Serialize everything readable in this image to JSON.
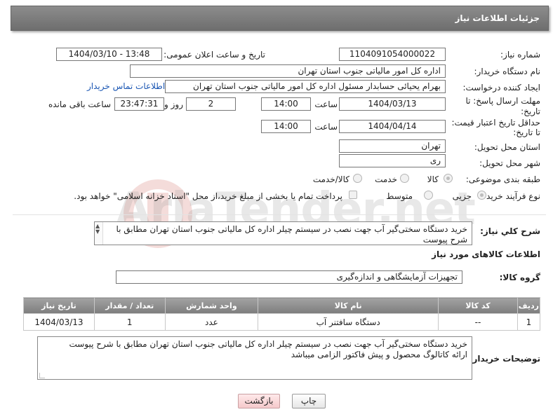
{
  "header": {
    "title": "جزئیات اطلاعات نیاز"
  },
  "fields": {
    "need_number_label": "شماره نیاز:",
    "need_number": "1104091054000022",
    "announce_label": "تاریخ و ساعت اعلان عمومی:",
    "announce_value": "1404/03/10 - 13:48",
    "buyer_org_label": "نام دستگاه خریدار:",
    "buyer_org": "اداره کل امور مالیاتی جنوب استان تهران",
    "requester_label": "ایجاد کننده درخواست:",
    "requester": "بهرام یحیائی حسابدار مسئول اداره کل امور مالیاتی جنوب استان تهران",
    "contact_link": "اطلاعات تماس خریدار",
    "deadline_label_1": "مهلت ارسال پاسخ: تا",
    "deadline_label_2": "تاریخ:",
    "deadline_date": "1404/03/13",
    "time_label": "ساعت",
    "deadline_time": "14:00",
    "days_value": "2",
    "days_label": "روز و",
    "remaining_time": "23:47:31",
    "remaining_label": "ساعت باقی مانده",
    "price_label_1": "حداقل تاریخ اعتبار قیمت:",
    "price_label_2": "تا تاریخ:",
    "price_date": "1404/04/14",
    "price_time": "14:00",
    "province_label": "استان محل تحویل:",
    "province": "تهران",
    "city_label": "شهر محل تحویل:",
    "city": "ری",
    "category_label": "طبقه بندی موضوعی:",
    "category_options": [
      "کالا",
      "خدمت",
      "کالا/خدمت"
    ],
    "process_label": "نوع فرآیند خرید :",
    "process_options": [
      "جزیی",
      "متوسط"
    ],
    "payment_note": "پرداخت تمام یا بخشی از مبلغ خرید،از محل \"اسناد خزانه اسلامی\" خواهد بود."
  },
  "description": {
    "label": "شرح کلي نياز:",
    "text": "خرید دستگاه سختی‌گیر آب جهت نصب در سیستم چیلر اداره کل مالیاتی جنوب استان تهران مطابق با شرح پیوست"
  },
  "goods_section": {
    "title": "اطلاعات کالاهای مورد نیاز",
    "group_label": "گروه کالا:",
    "group_value": "تجهیزات آزمایشگاهی و اندازه‌گیری"
  },
  "table": {
    "headers": [
      "ردیف",
      "کد کالا",
      "نام کالا",
      "واحد شمارش",
      "تعداد / مقدار",
      "تاریخ نیاز"
    ],
    "rows": [
      [
        "1",
        "--",
        "دستگاه سافتنر آب",
        "عدد",
        "1",
        "1404/03/13"
      ]
    ]
  },
  "buyer_notes": {
    "label": "توضیحات خریدار:",
    "line1": "خرید دستگاه سختی‌گیر آب جهت نصب در سیستم چیلر اداره کل مالیاتی جنوب استان تهران مطابق با شرح پیوست",
    "line2": "ارائه کاتالوگ محصول و پیش فاکتور الزامی میباشد"
  },
  "buttons": {
    "print": "چاپ",
    "back": "بازگشت"
  },
  "watermark": {
    "brand": "AriaTender.net"
  }
}
